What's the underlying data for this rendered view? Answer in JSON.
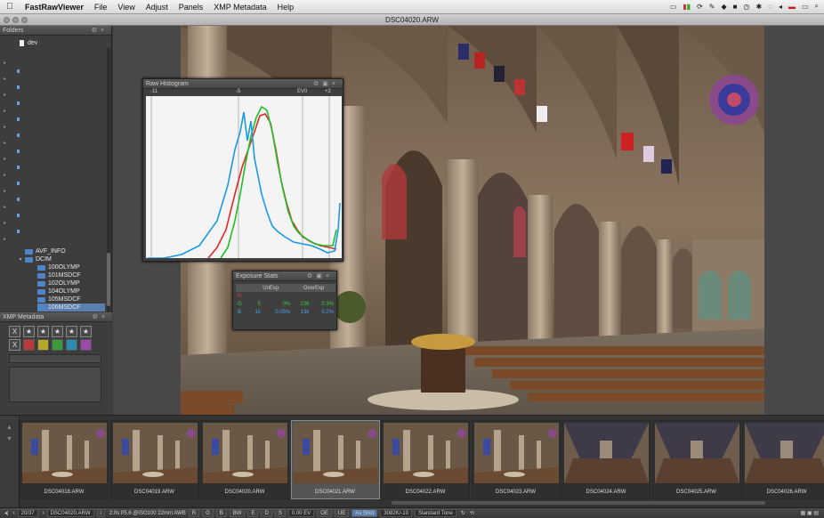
{
  "menubar": {
    "app_name": "FastRawViewer",
    "items": [
      "File",
      "View",
      "Adjust",
      "Panels",
      "XMP Metadata",
      "Help"
    ]
  },
  "window": {
    "title": "DSC04020.ARW"
  },
  "folders_panel": {
    "title": "Folders",
    "top_item": "dev",
    "items": [
      {
        "label": "AVF_INFO",
        "selected": false,
        "depth": 1
      },
      {
        "label": "DCIM",
        "selected": false,
        "depth": 1
      },
      {
        "label": "100OLYMP",
        "selected": false,
        "depth": 2
      },
      {
        "label": "101MSDCF",
        "selected": false,
        "depth": 2
      },
      {
        "label": "102OLYMP",
        "selected": false,
        "depth": 2
      },
      {
        "label": "104OLYMP",
        "selected": false,
        "depth": 2
      },
      {
        "label": "105MSDCF",
        "selected": false,
        "depth": 2
      },
      {
        "label": "106MSDCF",
        "selected": true,
        "depth": 2
      }
    ]
  },
  "histogram_panel": {
    "title": "Raw Histogram",
    "ticks": [
      "-11",
      "-5",
      "EV0",
      "+2"
    ]
  },
  "exposure_stats": {
    "title": "Exposure Stats",
    "headers": [
      "",
      "UnExp",
      "",
      "OverExp",
      ""
    ],
    "rows": [
      {
        "channel": "R",
        "color": "#e04040",
        "values": [
          "",
          "",
          "",
          ""
        ]
      },
      {
        "channel": "G",
        "color": "#33cc33",
        "values": [
          "5",
          "0%",
          "236",
          "0.3%"
        ]
      },
      {
        "channel": "B",
        "color": "#4aa0e8",
        "values": [
          "1k",
          "0.05%",
          "13k",
          "0.2%"
        ]
      }
    ]
  },
  "xmp_panel": {
    "title": "XMP Metadata",
    "rating_buttons": [
      "X",
      "★",
      "★",
      "★",
      "★",
      "★"
    ],
    "label_colors": [
      "#b83a3a",
      "#b8a82a",
      "#3a9a3a",
      "#2a8ab0",
      "#9a4aa8"
    ]
  },
  "filmstrip": {
    "thumbnails": [
      {
        "name": "DSC04018.ARW",
        "selected": false
      },
      {
        "name": "DSC04019.ARW",
        "selected": false
      },
      {
        "name": "DSC04020.ARW",
        "selected": false
      },
      {
        "name": "DSC04021.ARW",
        "selected": true
      },
      {
        "name": "DSC04022.ARW",
        "selected": false
      },
      {
        "name": "DSC04023.ARW",
        "selected": false
      },
      {
        "name": "DSC04024.ARW",
        "selected": false
      },
      {
        "name": "DSC04025.ARW",
        "selected": false
      },
      {
        "name": "DSC04026.ARW",
        "selected": false
      }
    ]
  },
  "toolbar": {
    "position": "20/37",
    "filename": "DSC04020.ARW",
    "exif": "2.0s f/5.6 @ISO100 22mm AWB",
    "channels": [
      "R",
      "G",
      "B",
      "BW"
    ],
    "flags": [
      "E",
      "D",
      "S"
    ],
    "ev": "0.00 EV",
    "oe": "OE",
    "ue": "UE",
    "wb": "As Shot",
    "temp": "3082K/-10",
    "tone": "Standard Tone"
  }
}
